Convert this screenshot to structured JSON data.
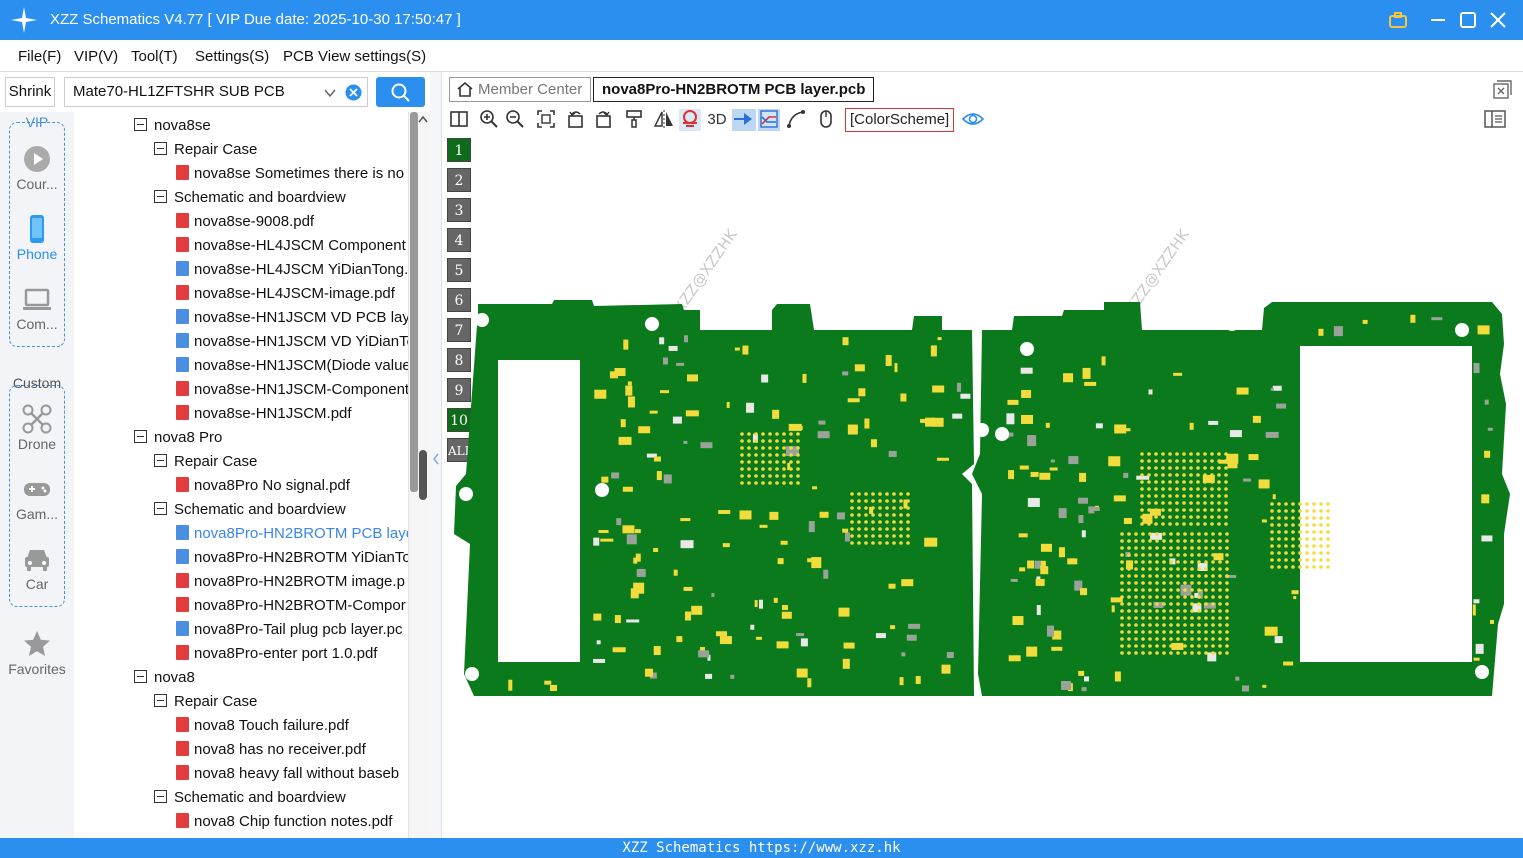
{
  "window": {
    "title": "XZZ Schematics V4.77 [ VIP Due date: 2025-10-30 17:50:47 ]"
  },
  "menu": [
    "File(F)",
    "VIP(V)",
    "Tool(T)",
    "Settings(S)",
    "PCB View settings(S)"
  ],
  "search": {
    "shrink_label": "Shrink",
    "value": "Mate70-HL1ZFTSHR SUB PCB"
  },
  "nav": {
    "vip_label": "VIP",
    "custom_label": "Custom",
    "items": [
      "Cour...",
      "Phone",
      "Com...",
      "Drone",
      "Gam...",
      "Car",
      "Favorites"
    ]
  },
  "tree": [
    {
      "type": "folder",
      "level": 0,
      "label": "nova8se"
    },
    {
      "type": "folder",
      "level": 1,
      "label": "Repair Case"
    },
    {
      "type": "pdf",
      "level": 2,
      "label": "nova8se Sometimes there is no"
    },
    {
      "type": "folder",
      "level": 1,
      "label": "Schematic and boardview"
    },
    {
      "type": "pdf",
      "level": 2,
      "label": "nova8se-9008.pdf"
    },
    {
      "type": "pdf",
      "level": 2,
      "label": "nova8se-HL4JSCM Component"
    },
    {
      "type": "pcb",
      "level": 2,
      "label": "nova8se-HL4JSCM YiDianTong."
    },
    {
      "type": "pdf",
      "level": 2,
      "label": "nova8se-HL4JSCM-image.pdf"
    },
    {
      "type": "pcb",
      "level": 2,
      "label": "nova8se-HN1JSCM VD PCB laye"
    },
    {
      "type": "pcb",
      "level": 2,
      "label": "nova8se-HN1JSCM VD YiDianTo"
    },
    {
      "type": "pcb",
      "level": 2,
      "label": "nova8se-HN1JSCM(Diode value"
    },
    {
      "type": "pdf",
      "level": 2,
      "label": "nova8se-HN1JSCM-Component"
    },
    {
      "type": "pdf",
      "level": 2,
      "label": "nova8se-HN1JSCM.pdf"
    },
    {
      "type": "folder",
      "level": 0,
      "label": "nova8 Pro"
    },
    {
      "type": "folder",
      "level": 1,
      "label": "Repair Case"
    },
    {
      "type": "pdf",
      "level": 2,
      "label": "nova8Pro No signal.pdf"
    },
    {
      "type": "folder",
      "level": 1,
      "label": "Schematic and boardview"
    },
    {
      "type": "pcb",
      "level": 2,
      "label": "nova8Pro-HN2BROTM PCB laye",
      "selected": true
    },
    {
      "type": "pcb",
      "level": 2,
      "label": "nova8Pro-HN2BROTM YiDianTo"
    },
    {
      "type": "pdf",
      "level": 2,
      "label": "nova8Pro-HN2BROTM image.p"
    },
    {
      "type": "pdf",
      "level": 2,
      "label": "nova8Pro-HN2BROTM-Compor"
    },
    {
      "type": "pcb",
      "level": 2,
      "label": "nova8Pro-Tail plug pcb layer.pc"
    },
    {
      "type": "pdf",
      "level": 2,
      "label": "nova8Pro-enter port 1.0.pdf"
    },
    {
      "type": "folder",
      "level": 0,
      "label": "nova8"
    },
    {
      "type": "folder",
      "level": 1,
      "label": "Repair Case"
    },
    {
      "type": "pdf",
      "level": 2,
      "label": "nova8 Touch failure.pdf"
    },
    {
      "type": "pdf",
      "level": 2,
      "label": "nova8 has no receiver.pdf"
    },
    {
      "type": "pdf",
      "level": 2,
      "label": "nova8 heavy fall without baseb"
    },
    {
      "type": "folder",
      "level": 1,
      "label": "Schematic and boardview"
    },
    {
      "type": "pdf",
      "level": 2,
      "label": "nova8 Chip function notes.pdf"
    }
  ],
  "tabs": {
    "member_center": "Member Center",
    "active_file": "nova8Pro-HN2BROTM PCB layer.pcb"
  },
  "toolbar": {
    "three_d": "3D",
    "color_scheme": "[ColorScheme]"
  },
  "layers": [
    "1",
    "2",
    "3",
    "4",
    "5",
    "6",
    "7",
    "8",
    "9",
    "10",
    "ALL"
  ],
  "active_layers": [
    "1",
    "10"
  ],
  "watermark": "XZZ@XZZHK",
  "colors": {
    "accent": "#2b8ff0",
    "pcb_green": "#0b7a1c",
    "pad_yellow": "#f2dc3c"
  },
  "status": "XZZ Schematics https://www.xzz.hk"
}
